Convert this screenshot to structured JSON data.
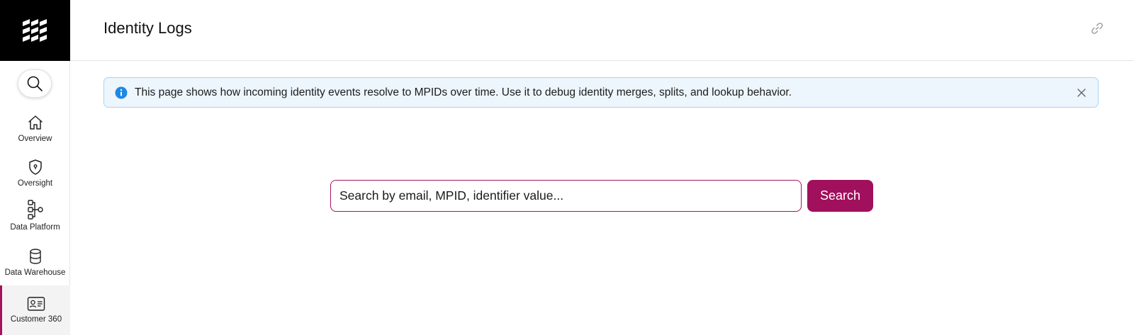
{
  "header": {
    "title": "Identity Logs"
  },
  "banner": {
    "text": "This page shows how incoming identity events resolve to MPIDs over time. Use it to debug identity merges, splits, and lookup behavior."
  },
  "search": {
    "placeholder": "Search by email, MPID, identifier value...",
    "button_label": "Search"
  },
  "sidebar": {
    "items": [
      {
        "label": "Overview",
        "icon": "home-icon"
      },
      {
        "label": "Oversight",
        "icon": "shield-icon"
      },
      {
        "label": "Data Platform",
        "icon": "data-platform-icon"
      },
      {
        "label": "Data Warehouse",
        "icon": "database-icon"
      },
      {
        "label": "Customer 360",
        "icon": "id-card-icon",
        "active": true
      }
    ]
  },
  "colors": {
    "accent": "#a0105c",
    "banner_bg": "#edf6fd",
    "banner_border": "#a9d3f5",
    "info": "#1e88e5",
    "logo_bg": "#000000"
  }
}
